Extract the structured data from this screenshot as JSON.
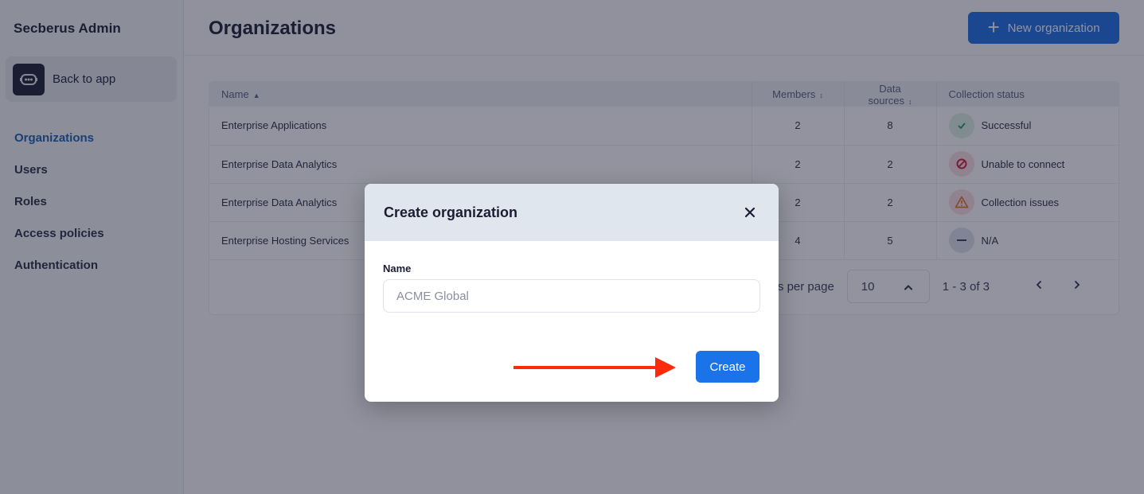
{
  "sidebar": {
    "brand": "Secberus Admin",
    "back_to_app": "Back to app",
    "items": [
      {
        "label": "Organizations",
        "active": true
      },
      {
        "label": "Users",
        "active": false
      },
      {
        "label": "Roles",
        "active": false
      },
      {
        "label": "Access policies",
        "active": false
      },
      {
        "label": "Authentication",
        "active": false
      }
    ]
  },
  "header": {
    "title": "Organizations",
    "new_button_label": "New organization"
  },
  "table": {
    "columns": [
      "Name",
      "Members",
      "Data sources",
      "Collection status"
    ],
    "rows": [
      {
        "name": "Enterprise Applications",
        "members": "2",
        "data_sources": "8",
        "status": "Successful",
        "status_icon": "check-icon"
      },
      {
        "name": "Enterprise Data Analytics",
        "members": "2",
        "data_sources": "2",
        "status": "Unable to connect",
        "status_icon": "blocked-icon"
      },
      {
        "name": "Enterprise Data Analytics",
        "members": "2",
        "data_sources": "2",
        "status": "Collection issues",
        "status_icon": "warning-icon"
      },
      {
        "name": "Enterprise Hosting Services",
        "members": "4",
        "data_sources": "5",
        "status": "N/A",
        "status_icon": "minus-icon"
      }
    ],
    "status_colors": {
      "success": "#1f9d55",
      "error": "#d0223a",
      "warning": "#e07a1f",
      "na": "#5b6079"
    }
  },
  "pagination": {
    "rows_per_page_label": "Rows per page",
    "rows_per_page_value": "10",
    "range_text": "1 - 3 of 3"
  },
  "modal": {
    "title": "Create organization",
    "name_label": "Name",
    "name_placeholder": "ACME Global",
    "name_value": "",
    "create_label": "Create"
  },
  "colors": {
    "primary": "#1a73e8",
    "active_nav": "#1a5fb4",
    "annotation_arrow": "#ff2a0a"
  }
}
